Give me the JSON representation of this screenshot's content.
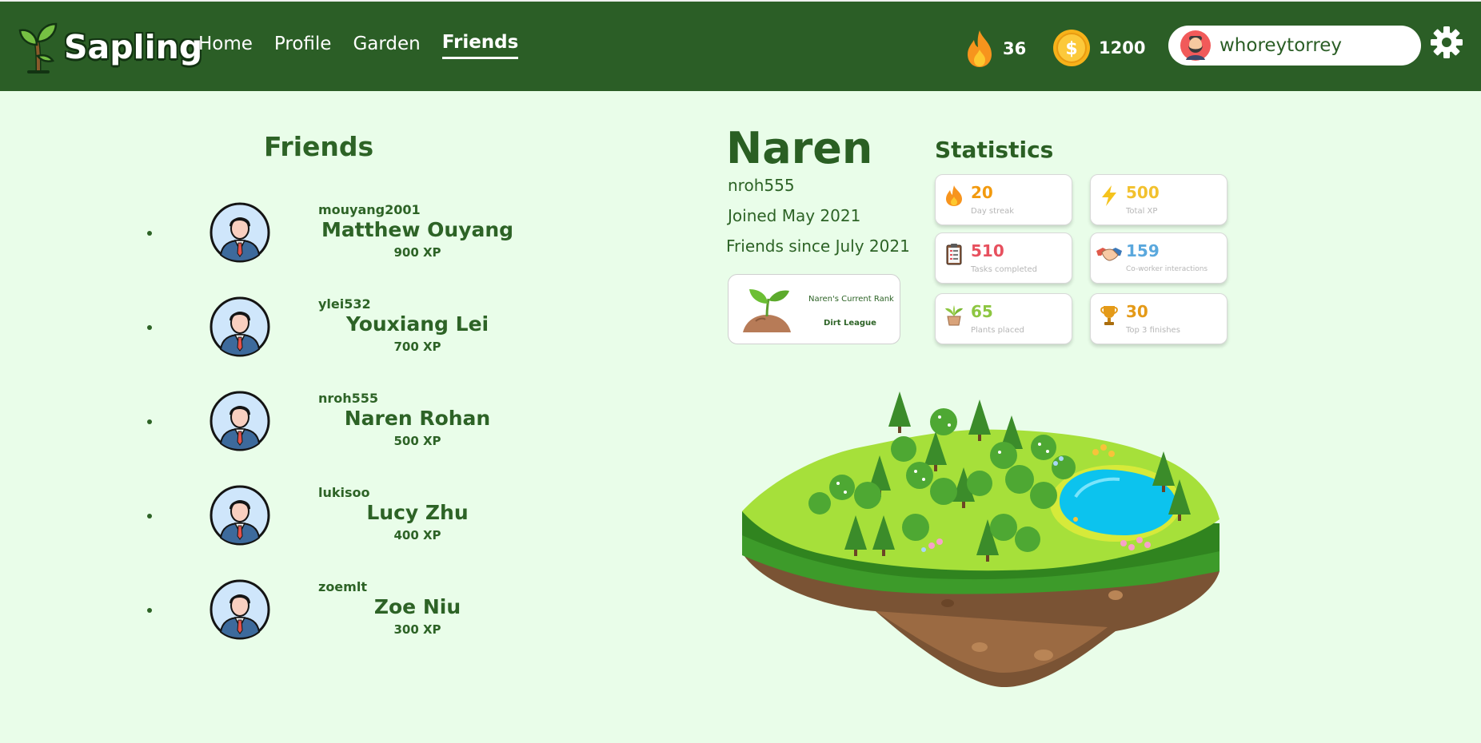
{
  "app": {
    "name": "Sapling"
  },
  "nav": {
    "items": [
      {
        "label": "Home",
        "active": false
      },
      {
        "label": "Profile",
        "active": false
      },
      {
        "label": "Garden",
        "active": false
      },
      {
        "label": "Friends",
        "active": true
      }
    ]
  },
  "header": {
    "streak": "36",
    "coins": "1200",
    "username": "whoreytorrey",
    "icons": [
      "flame-icon",
      "coin-icon",
      "avatar",
      "gear-icon"
    ]
  },
  "friends": {
    "title": "Friends",
    "items": [
      {
        "handle": "mouyang2001",
        "name": "Matthew Ouyang",
        "xp": "900 XP"
      },
      {
        "handle": "ylei532",
        "name": "Youxiang Lei",
        "xp": "700 XP"
      },
      {
        "handle": "nroh555",
        "name": "Naren Rohan",
        "xp": "500 XP"
      },
      {
        "handle": "lukisoo",
        "name": "Lucy Zhu",
        "xp": "400 XP"
      },
      {
        "handle": "zoemlt",
        "name": "Zoe Niu",
        "xp": "300 XP"
      }
    ]
  },
  "profile": {
    "name": "Naren",
    "handle": "nroh555",
    "joined": "Joined May 2021",
    "friends_since": "Friends since July 2021",
    "rank": {
      "label": "Naren's Current Rank",
      "value": "Dirt League"
    }
  },
  "statistics": {
    "title": "Statistics",
    "items": [
      {
        "value": "20",
        "label": "Day streak",
        "color": "#f29a0e",
        "icon": "flame-icon"
      },
      {
        "value": "500",
        "label": "Total XP",
        "color": "#f2c12e",
        "icon": "lightning-icon"
      },
      {
        "value": "510",
        "label": "Tasks completed",
        "color": "#e7505e",
        "icon": "clipboard-icon"
      },
      {
        "value": "159",
        "label": "Co-worker interactions",
        "color": "#5aa8dd",
        "icon": "handshake-icon"
      },
      {
        "value": "65",
        "label": "Plants placed",
        "color": "#8dc641",
        "icon": "potted-plant-icon"
      },
      {
        "value": "30",
        "label": "Top 3 finishes",
        "color": "#e49a18",
        "icon": "trophy-icon"
      }
    ]
  }
}
